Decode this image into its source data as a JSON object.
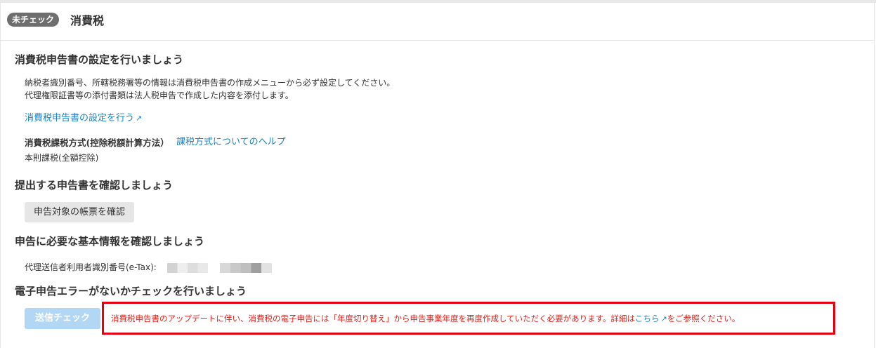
{
  "header": {
    "badge": "未チェック",
    "title": "消費税"
  },
  "section1": {
    "heading": "消費税申告書の設定を行いましょう",
    "line1": "納税者識別番号、所轄税務署等の情報は消費税申告書の作成メニューから必ず設定してください。",
    "line2": "代理権限証書等の添付書類は法人税申告で作成した内容を添付します。",
    "settings_link": "消費税申告書の設定を行う",
    "method_label": "消費税課税方式(控除税額計算方法）",
    "method_help_link": "課税方式についてのヘルプ",
    "method_value": "本則課税(全額控除)"
  },
  "section2": {
    "heading": "提出する申告書を確認しましょう",
    "button": "申告対象の帳票を確認"
  },
  "section3": {
    "heading": "申告に必要な基本情報を確認しましょう",
    "label": "代理送信者利用者識別番号(e-Tax):"
  },
  "section4": {
    "heading": "電子申告エラーがないかチェックを行いましょう",
    "button": "送信チェック",
    "alert_text": "消費税申告書のアップデートに伴い、消費税の電子申告には「年度切り替え」から申告事業年度を再度作成していただく必要があります。詳細は",
    "alert_link": "こちら",
    "alert_suffix": "をご参照ください。"
  },
  "icons": {
    "external_link": "external-link-icon"
  },
  "colors": {
    "link": "#1a84c7",
    "alert_border": "#e60012",
    "alert_text": "#e0211a",
    "badge_bg": "#6e6e6e",
    "send_button": "#b2d7f5"
  }
}
